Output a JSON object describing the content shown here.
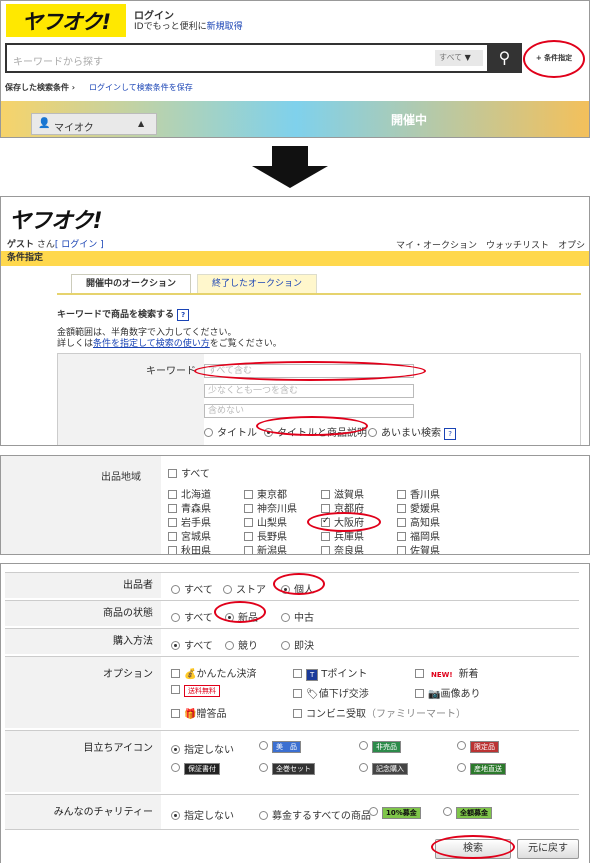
{
  "top": {
    "logo": "ヤフオク!",
    "login": "ログイン",
    "login_sub_prefix": "IDでもっと便利に",
    "register": "新規取得",
    "search_placeholder": "キーワードから探す",
    "category_select": "すべて",
    "cond_btn": "+ 条件指定",
    "saved_label": "保存した検索条件",
    "saved_link": "ログインして検索条件を保存",
    "myauc": "マイオク",
    "banner_text": "開催中"
  },
  "detail": {
    "logo": "ヤフオク!",
    "guest": "ゲスト",
    "san": "さん",
    "login": "[ ログイン ]",
    "nav": [
      "マイ・オークション",
      "ウォッチリスト",
      "オプション/"
    ],
    "bar": "条件指定",
    "tabs": [
      "開催中のオークション",
      "終了したオークション"
    ],
    "kw_title": "キーワードで商品を検索する",
    "help": "?",
    "note1": "金額範囲は、半角数字で入力してください。",
    "note2_prefix": "詳しくは",
    "note2_link": "条件を指定して検索の使い方",
    "note2_suffix": "をご覧ください。",
    "kw_label": "キーワード",
    "kw_ph": [
      "すべて含む",
      "少なくとも一つを含む",
      "含めない"
    ],
    "scope": [
      "タイトル",
      "タイトルと商品説明",
      "あいまい検索"
    ]
  },
  "region": {
    "label": "出品地域",
    "all": "すべて",
    "prefs": [
      [
        "北海道",
        "東京都",
        "滋賀県",
        "香川県"
      ],
      [
        "青森県",
        "神奈川県",
        "京都府",
        "愛媛県"
      ],
      [
        "岩手県",
        "山梨県",
        "大阪府",
        "高知県"
      ],
      [
        "宮城県",
        "長野県",
        "兵庫県",
        "福岡県"
      ],
      [
        "秋田県",
        "新潟県",
        "奈良県",
        "佐賀県"
      ]
    ]
  },
  "filters": {
    "seller": {
      "label": "出品者",
      "opts": [
        "すべて",
        "ストア",
        "個人"
      ]
    },
    "condition": {
      "label": "商品の状態",
      "opts": [
        "すべて",
        "新品",
        "中古"
      ]
    },
    "buy": {
      "label": "購入方法",
      "opts": [
        "すべて",
        "競り",
        "即決"
      ]
    },
    "option": {
      "label": "オプション",
      "items": [
        [
          "かんたん決済",
          "Tポイント",
          "新着"
        ],
        [
          "送料無料",
          "値下げ交渉",
          "画像あり"
        ],
        [
          "贈答品",
          "コンビニ受取",
          "（ファミリーマート）"
        ]
      ],
      "new_badge": "NEW!"
    },
    "icons": {
      "label": "目立ちアイコン",
      "none": "指定しない",
      "items": [
        "美　品",
        "非売品",
        "限定品",
        "保証書付",
        "全巻セット",
        "記念購入",
        "産地直送"
      ]
    },
    "charity": {
      "label": "みんなのチャリティー",
      "opts": [
        "指定しない",
        "募金するすべての商品",
        "10%募金",
        "全額募金"
      ]
    }
  },
  "buttons": {
    "search": "検索",
    "reset": "元に戻す"
  },
  "colors": {
    "yellow": "#ffe800",
    "red": "#e0001a",
    "bar": "#ffd84d"
  }
}
